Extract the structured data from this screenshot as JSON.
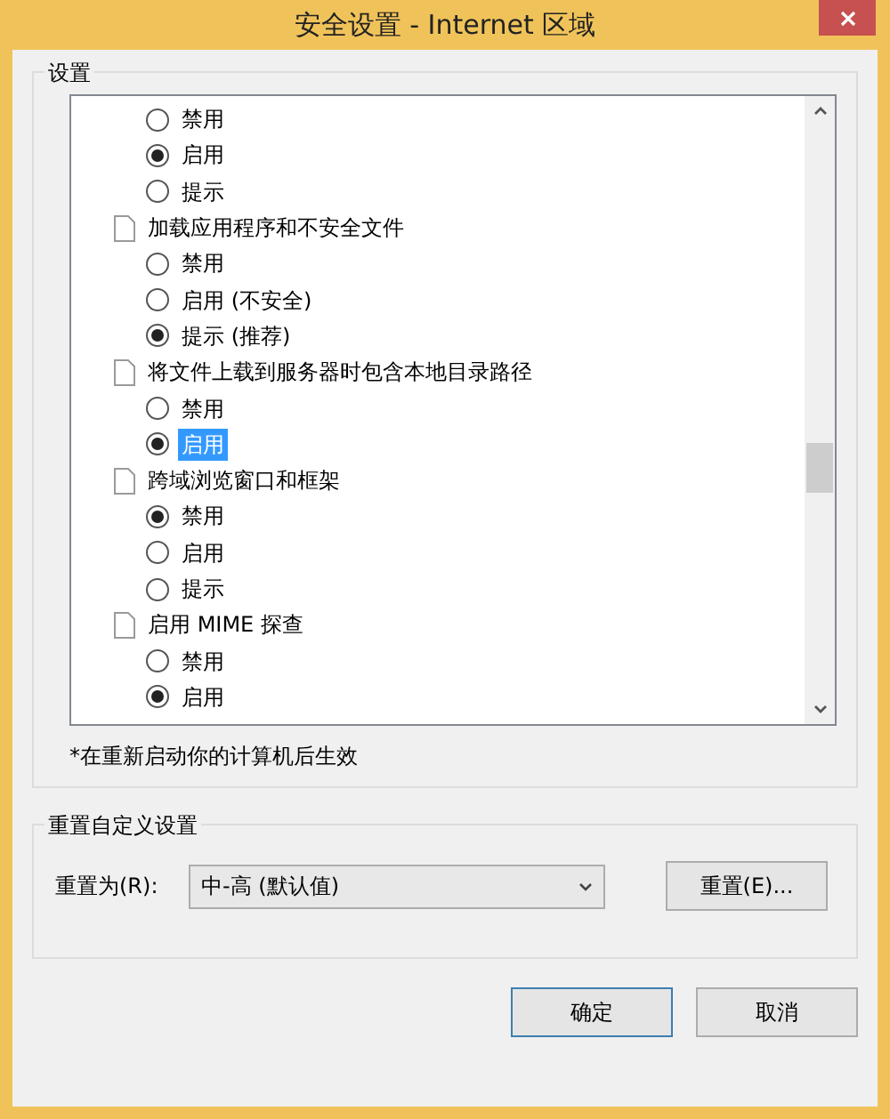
{
  "window": {
    "title": "安全设置 - Internet 区域"
  },
  "settings": {
    "legend": "设置",
    "items": [
      {
        "kind": "option",
        "label": "禁用",
        "checked": false,
        "selected": false
      },
      {
        "kind": "option",
        "label": "启用",
        "checked": true,
        "selected": false
      },
      {
        "kind": "option",
        "label": "提示",
        "checked": false,
        "selected": false
      },
      {
        "kind": "category",
        "label": "加载应用程序和不安全文件",
        "selected": false,
        "children": [
          {
            "kind": "option",
            "label": "禁用",
            "checked": false,
            "selected": false
          },
          {
            "kind": "option",
            "label": "启用 (不安全)",
            "checked": false,
            "selected": false
          },
          {
            "kind": "option",
            "label": "提示 (推荐)",
            "checked": true,
            "selected": false
          }
        ]
      },
      {
        "kind": "category",
        "label": "将文件上载到服务器时包含本地目录路径",
        "selected": false,
        "children": [
          {
            "kind": "option",
            "label": "禁用",
            "checked": false,
            "selected": false
          },
          {
            "kind": "option",
            "label": "启用",
            "checked": true,
            "selected": true
          }
        ]
      },
      {
        "kind": "category",
        "label": "跨域浏览窗口和框架",
        "selected": false,
        "children": [
          {
            "kind": "option",
            "label": "禁用",
            "checked": true,
            "selected": false
          },
          {
            "kind": "option",
            "label": "启用",
            "checked": false,
            "selected": false
          },
          {
            "kind": "option",
            "label": "提示",
            "checked": false,
            "selected": false
          }
        ]
      },
      {
        "kind": "category",
        "label": "启用 MIME 探查",
        "selected": false,
        "children": [
          {
            "kind": "option",
            "label": "禁用",
            "checked": false,
            "selected": false
          },
          {
            "kind": "option",
            "label": "启用",
            "checked": true,
            "selected": false
          }
        ]
      }
    ],
    "note": "*在重新启动你的计算机后生效"
  },
  "reset": {
    "legend": "重置自定义设置",
    "label": "重置为(R):",
    "value": "中-高 (默认值)",
    "button": "重置(E)..."
  },
  "buttons": [
    {
      "label": "确定",
      "default": true
    },
    {
      "label": "取消",
      "default": false
    }
  ]
}
